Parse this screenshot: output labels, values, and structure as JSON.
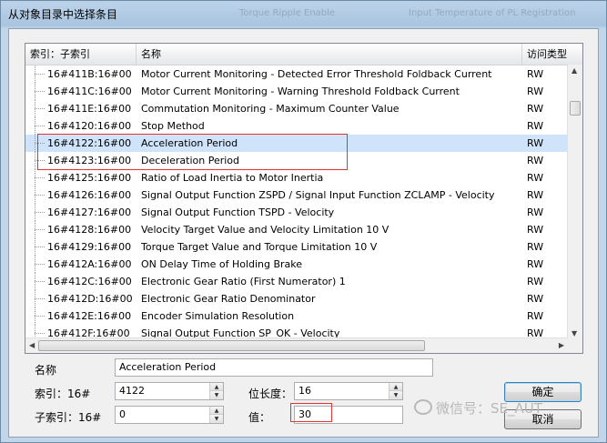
{
  "window": {
    "title": "从对象目录中选择条目",
    "ghost_tabs": [
      "Torque Ripple Enable",
      "Input Temperature of PL Registration"
    ]
  },
  "table": {
    "columns": [
      "索引：子索引",
      "名称",
      "访问类型"
    ],
    "rows": [
      {
        "index": "16#411B:16#00",
        "name": "Motor Current Monitoring - Detected Error Threshold Foldback Current",
        "access": "RW",
        "selected": false
      },
      {
        "index": "16#411C:16#00",
        "name": "Motor Current Monitoring - Warning Threshold Foldback Current",
        "access": "RW",
        "selected": false
      },
      {
        "index": "16#411E:16#00",
        "name": "Commutation Monitoring - Maximum Counter Value",
        "access": "RW",
        "selected": false
      },
      {
        "index": "16#4120:16#00",
        "name": "Stop Method",
        "access": "RW",
        "selected": false
      },
      {
        "index": "16#4122:16#00",
        "name": "Acceleration Period",
        "access": "RW",
        "selected": true
      },
      {
        "index": "16#4123:16#00",
        "name": "Deceleration Period",
        "access": "RW",
        "selected": false
      },
      {
        "index": "16#4125:16#00",
        "name": "Ratio of Load Inertia to Motor Inertia",
        "access": "RW",
        "selected": false
      },
      {
        "index": "16#4126:16#00",
        "name": "Signal Output Function ZSPD / Signal Input Function ZCLAMP - Velocity",
        "access": "RW",
        "selected": false
      },
      {
        "index": "16#4127:16#00",
        "name": "Signal Output Function TSPD - Velocity",
        "access": "RW",
        "selected": false
      },
      {
        "index": "16#4128:16#00",
        "name": "Velocity Target Value and Velocity Limitation 10 V",
        "access": "RW",
        "selected": false
      },
      {
        "index": "16#4129:16#00",
        "name": "Torque Target Value and Torque Limitation 10 V",
        "access": "RW",
        "selected": false
      },
      {
        "index": "16#412A:16#00",
        "name": "ON Delay Time of Holding Brake",
        "access": "RW",
        "selected": false
      },
      {
        "index": "16#412C:16#00",
        "name": "Electronic Gear Ratio (First Numerator) 1",
        "access": "RW",
        "selected": false
      },
      {
        "index": "16#412D:16#00",
        "name": "Electronic Gear Ratio Denominator",
        "access": "RW",
        "selected": false
      },
      {
        "index": "16#412E:16#00",
        "name": "Encoder Simulation Resolution",
        "access": "RW",
        "selected": false
      },
      {
        "index": "16#412F:16#00",
        "name": "Signal Output Function SP_OK - Velocity",
        "access": "RW",
        "selected": false
      }
    ]
  },
  "form": {
    "name_label": "名称",
    "name_value": "Acceleration Period",
    "index_label": "索引：16#",
    "index_value": "4122",
    "subindex_label": "子索引：16#",
    "subindex_value": "0",
    "bitlength_label": "位长度：",
    "bitlength_value": "16",
    "value_label": "值：",
    "value_value": "30",
    "ok_label": "确定",
    "cancel_label": "取消"
  },
  "watermark": "微信号：SE_AUT",
  "colors": {
    "selected_row": "#cfe3fb",
    "highlight_border": "#e53333"
  }
}
